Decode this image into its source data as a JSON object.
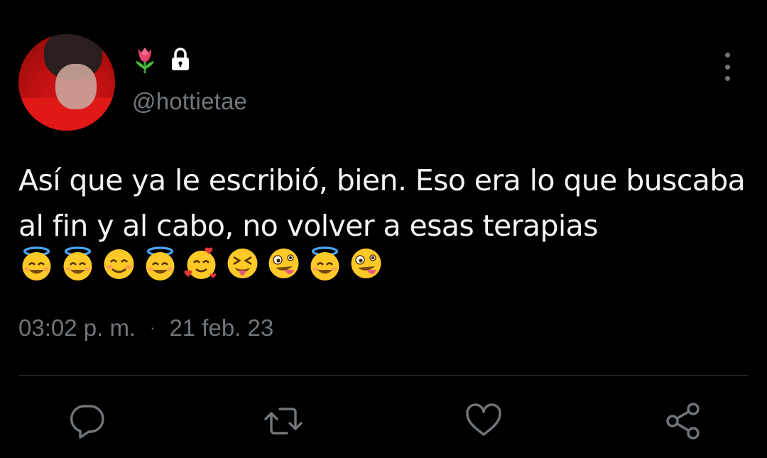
{
  "user": {
    "name_emoji": "🌷",
    "handle": "@hottietae",
    "protected": true
  },
  "tweet": {
    "text": "Así que ya le escribió, bien. Eso era lo que buscaba al fin y al cabo, no volver a esas terapias",
    "emojis": [
      "😇",
      "😇",
      "😊",
      "😇",
      "🥰",
      "😝",
      "🤪",
      "😇",
      "🤪"
    ],
    "time": "03:02 p. m.",
    "separator": "·",
    "date": "21 feb. 23"
  },
  "icons": {
    "reply": "reply-icon",
    "retweet": "retweet-icon",
    "like": "heart-icon",
    "share": "share-icon",
    "more": "more-vertical-icon",
    "lock": "lock-icon",
    "tulip": "tulip-icon"
  },
  "colors": {
    "background": "#000000",
    "text": "#e7e9ea",
    "secondary": "#71767b",
    "divider": "#2f3336"
  }
}
